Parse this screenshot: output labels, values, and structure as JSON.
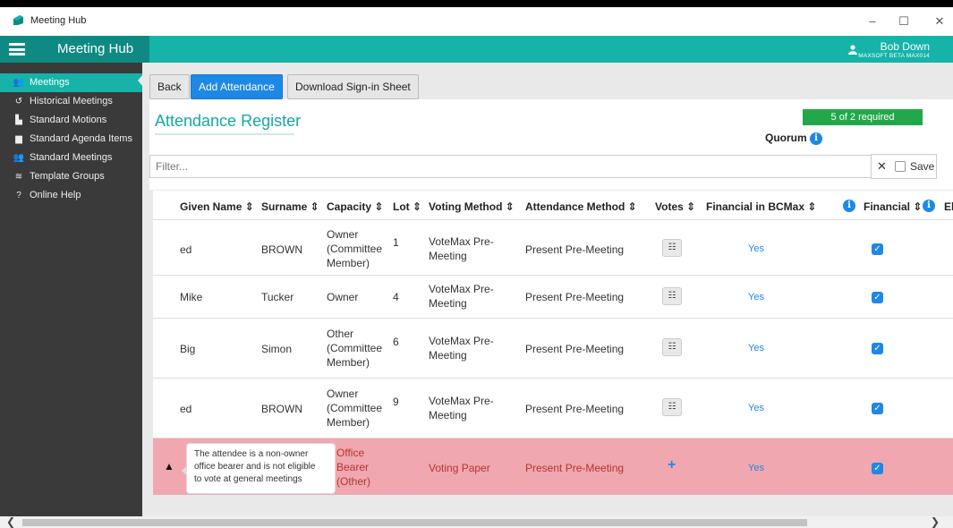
{
  "window": {
    "title": "Meeting Hub",
    "minimize": "–",
    "maximize": "☐",
    "close": "✕"
  },
  "header": {
    "app_name": "Meeting Hub",
    "user_name": "Bob Down",
    "user_org": "MAXSOFT BETA MAX014"
  },
  "sidebar": {
    "items": [
      {
        "label": "Meetings",
        "icon": "users-icon",
        "glyph": "👥",
        "active": true
      },
      {
        "label": "Historical Meetings",
        "icon": "history-icon",
        "glyph": "↺"
      },
      {
        "label": "Standard Motions",
        "icon": "podium-icon",
        "glyph": "▙"
      },
      {
        "label": "Standard Agenda Items",
        "icon": "agenda-icon",
        "glyph": "▆"
      },
      {
        "label": "Standard Meetings",
        "icon": "group-icon",
        "glyph": "👥"
      },
      {
        "label": "Template Groups",
        "icon": "layers-icon",
        "glyph": "≋"
      },
      {
        "label": "Online Help",
        "icon": "help-icon",
        "glyph": "?"
      }
    ]
  },
  "toolbar": {
    "back": "Back",
    "add_attendance": "Add Attendance",
    "download": "Download Sign-in Sheet"
  },
  "register": {
    "title": "Attendance Register",
    "quorum_status": "5 of 2 required",
    "quorum_label": "Quorum"
  },
  "filter": {
    "placeholder": "Filter...",
    "clear": "✕",
    "save_label": "Save"
  },
  "table": {
    "columns": [
      "Given Name ⇕",
      "Surname ⇕",
      "Capacity ⇕",
      "Lot ⇕",
      "Voting Method ⇕",
      "Attendance Method ⇕",
      "Votes ⇕",
      "Financial in BCMax ⇕",
      "Financial ⇕",
      "Eligi"
    ],
    "rows": [
      {
        "given": "ed",
        "surname": "BROWN",
        "capacity": [
          "Owner",
          "(Committee",
          "Member)"
        ],
        "lot": "1",
        "voting": [
          "VoteMax Pre-",
          "Meeting"
        ],
        "attendance": "Present Pre-Meeting",
        "financial_bcmax": "Yes"
      },
      {
        "given": "Mike",
        "surname": "Tucker",
        "capacity": [
          "Owner"
        ],
        "lot": "4",
        "voting": [
          "VoteMax Pre-",
          "Meeting"
        ],
        "attendance": "Present Pre-Meeting",
        "financial_bcmax": "Yes"
      },
      {
        "given": "Big",
        "surname": "Simon",
        "capacity": [
          "Other",
          "(Committee",
          "Member)"
        ],
        "lot": "6",
        "voting": [
          "VoteMax Pre-",
          "Meeting"
        ],
        "attendance": "Present Pre-Meeting",
        "financial_bcmax": "Yes"
      },
      {
        "given": "ed",
        "surname": "BROWN",
        "capacity": [
          "Owner",
          "(Committee",
          "Member)"
        ],
        "lot": "9",
        "voting": [
          "VoteMax Pre-",
          "Meeting"
        ],
        "attendance": "Present Pre-Meeting",
        "financial_bcmax": "Yes"
      }
    ],
    "warning_row": {
      "tooltip": [
        "The attendee is a non-owner",
        "office bearer and is not eligible",
        "to vote at general meetings"
      ],
      "capacity": [
        "Office",
        "Bearer",
        "(Other)"
      ],
      "voting": "Voting Paper",
      "attendance": "Present Pre-Meeting",
      "financial_bcmax": "Yes"
    }
  },
  "colors": {
    "teal": "#15b3a8",
    "sidebar": "#3a3a3a",
    "primary": "#1e88e5",
    "quorum_ok": "#22a84a",
    "warning_row": "#f0a7b0"
  }
}
